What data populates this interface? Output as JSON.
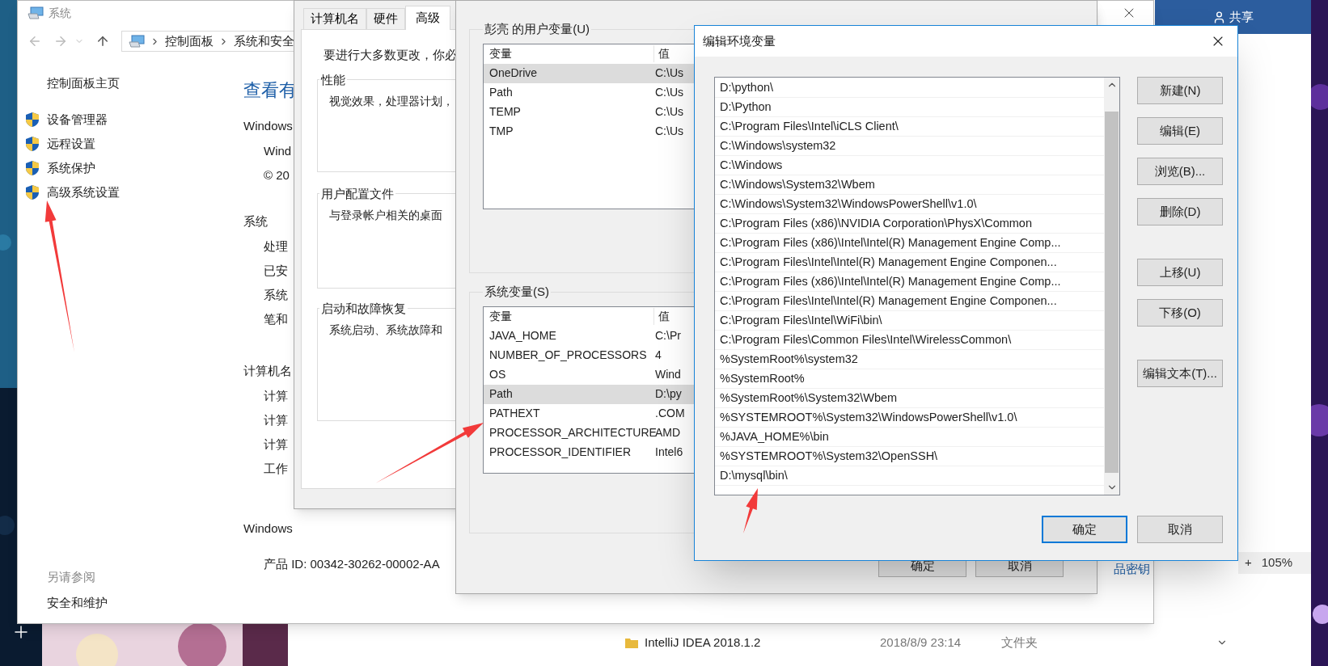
{
  "explorer": {
    "share_label": "共享",
    "zoom_plus": "+",
    "zoom": "105%",
    "rows": [
      {
        "name": "IntelliJ IDEA 2018.1.2",
        "date": "2018/8/9 23:14",
        "type": "文件夹"
      }
    ]
  },
  "system_window": {
    "title": "系统",
    "breadcrumb": [
      "控制面板",
      "系统和安全"
    ],
    "sidebar_home": "控制面板主页",
    "sidebar_links": [
      "设备管理器",
      "远程设置",
      "系统保护",
      "高级系统设置"
    ],
    "see_also": "另请参阅",
    "see_also_links": [
      "安全和维护"
    ],
    "heading": "查看有",
    "sections": [
      {
        "title": "Windows",
        "lines": [
          "Wind",
          "© 20"
        ]
      },
      {
        "title": "系统",
        "lines": [
          "处理",
          "已安",
          "系统",
          "笔和"
        ]
      },
      {
        "title": "计算机名",
        "lines": [
          "计算",
          "计算",
          "计算",
          "工作"
        ]
      },
      {
        "title": "Windows"
      }
    ],
    "product_id": "产品 ID: 00342-30262-00002-AA",
    "key_link": "品密钥"
  },
  "system_properties": {
    "tabs": [
      {
        "label": "计算机名",
        "selected": false
      },
      {
        "label": "硬件",
        "selected": false
      },
      {
        "label": "高级",
        "selected": true
      }
    ],
    "intro": "要进行大多数更改，你必",
    "groups": [
      {
        "title": "性能",
        "text": "视觉效果，处理器计划，"
      },
      {
        "title": "用户配置文件",
        "text": "与登录帐户相关的桌面"
      },
      {
        "title": "启动和故障恢复",
        "text": "系统启动、系统故障和"
      }
    ]
  },
  "environment_variables": {
    "groups": [
      {
        "title": "彭亮 的用户变量(U)",
        "columns": [
          "变量",
          "值"
        ],
        "rows": [
          {
            "name": "OneDrive",
            "value": "C:\\Us",
            "selected": true
          },
          {
            "name": "Path",
            "value": "C:\\Us",
            "selected": false
          },
          {
            "name": "TEMP",
            "value": "C:\\Us",
            "selected": false
          },
          {
            "name": "TMP",
            "value": "C:\\Us",
            "selected": false
          }
        ]
      },
      {
        "title": "系统变量(S)",
        "columns": [
          "变量",
          "值"
        ],
        "rows": [
          {
            "name": "JAVA_HOME",
            "value": "C:\\Pr",
            "selected": false
          },
          {
            "name": "NUMBER_OF_PROCESSORS",
            "value": "4",
            "selected": false
          },
          {
            "name": "OS",
            "value": "Wind",
            "selected": false
          },
          {
            "name": "Path",
            "value": "D:\\py",
            "selected": true
          },
          {
            "name": "PATHEXT",
            "value": ".COM",
            "selected": false
          },
          {
            "name": "PROCESSOR_ARCHITECTURE",
            "value": "AMD",
            "selected": false
          },
          {
            "name": "PROCESSOR_IDENTIFIER",
            "value": "Intel6",
            "selected": false
          }
        ]
      }
    ],
    "buttons": [
      "确定",
      "取消"
    ]
  },
  "edit_dialog": {
    "title": "编辑环境变量",
    "entries": [
      "D:\\python\\",
      "D:\\Python",
      "C:\\Program Files\\Intel\\iCLS Client\\",
      "C:\\Windows\\system32",
      "C:\\Windows",
      "C:\\Windows\\System32\\Wbem",
      "C:\\Windows\\System32\\WindowsPowerShell\\v1.0\\",
      "C:\\Program Files (x86)\\NVIDIA Corporation\\PhysX\\Common",
      "C:\\Program Files (x86)\\Intel\\Intel(R) Management Engine Comp...",
      "C:\\Program Files\\Intel\\Intel(R) Management Engine Componen...",
      "C:\\Program Files (x86)\\Intel\\Intel(R) Management Engine Comp...",
      "C:\\Program Files\\Intel\\Intel(R) Management Engine Componen...",
      "C:\\Program Files\\Intel\\WiFi\\bin\\",
      "C:\\Program Files\\Common Files\\Intel\\WirelessCommon\\",
      "%SystemRoot%\\system32",
      "%SystemRoot%",
      "%SystemRoot%\\System32\\Wbem",
      "%SYSTEMROOT%\\System32\\WindowsPowerShell\\v1.0\\",
      "%JAVA_HOME%\\bin",
      "%SYSTEMROOT%\\System32\\OpenSSH\\",
      "D:\\mysql\\bin\\"
    ],
    "side_buttons": [
      [
        "新建(N)",
        "编辑(E)",
        "浏览(B)...",
        "删除(D)"
      ],
      [
        "上移(U)",
        "下移(O)"
      ],
      [
        "编辑文本(T)..."
      ]
    ],
    "footer_buttons": [
      {
        "label": "确定",
        "default": true
      },
      {
        "label": "取消",
        "default": false
      }
    ]
  }
}
